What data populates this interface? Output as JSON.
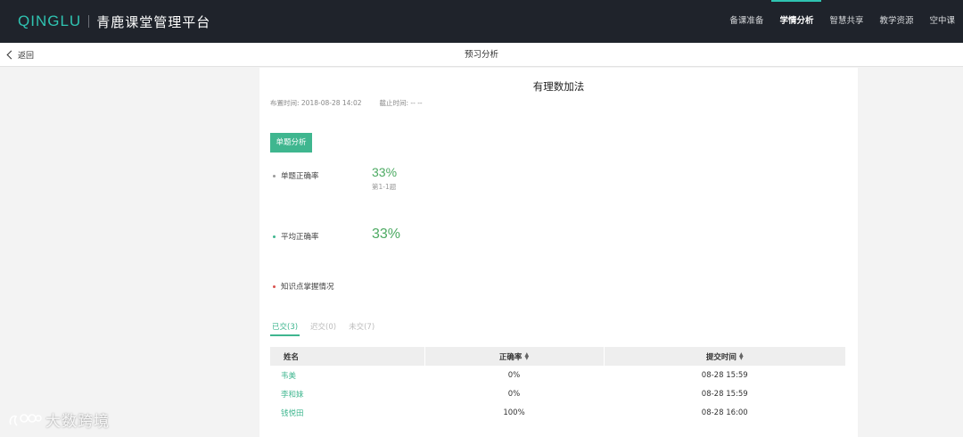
{
  "header": {
    "logo_mark": "QINGLU",
    "logo_text": "青鹿课堂管理平台",
    "nav": [
      {
        "label": "备课准备",
        "active": false
      },
      {
        "label": "学情分析",
        "active": true
      },
      {
        "label": "智慧共享",
        "active": false
      },
      {
        "label": "教学资源",
        "active": false
      },
      {
        "label": "空中课",
        "active": false
      }
    ]
  },
  "subbar": {
    "back_label": "返回",
    "title": "预习分析"
  },
  "homework": {
    "title": "有理数加法",
    "assigned_time": "布置时间: 2018-08-28 14:02",
    "deadline": "截止时间: -- --"
  },
  "analysis": {
    "section_tag": "单题分析",
    "single_accuracy_label": "单题正确率",
    "single_accuracy_value": "33%",
    "single_accuracy_sub": "第1-1题",
    "avg_accuracy_label": "平均正确率",
    "avg_accuracy_value": "33%",
    "knowledge_label": "知识点掌握情况"
  },
  "tabs": [
    {
      "label": "已交(3)",
      "active": true
    },
    {
      "label": "迟交(0)",
      "active": false
    },
    {
      "label": "未交(7)",
      "active": false
    }
  ],
  "table": {
    "headers": [
      "姓名",
      "正确率",
      "提交时间"
    ],
    "rows": [
      {
        "name": "韦美",
        "accuracy": "0%",
        "time": "08-28 15:59"
      },
      {
        "name": "李和妹",
        "accuracy": "0%",
        "time": "08-28 15:59"
      },
      {
        "name": "钱悦田",
        "accuracy": "100%",
        "time": "08-28 16:00"
      }
    ]
  },
  "watermark": {
    "text": "大数跨境"
  },
  "colors": {
    "accent": "#3fb68f",
    "header_bg": "#1f232b",
    "logo": "#2fc3b1",
    "value_green": "#4caa62",
    "dot_gray": "#999999",
    "dot_green": "#3fb68f",
    "dot_red": "#d9534f"
  }
}
